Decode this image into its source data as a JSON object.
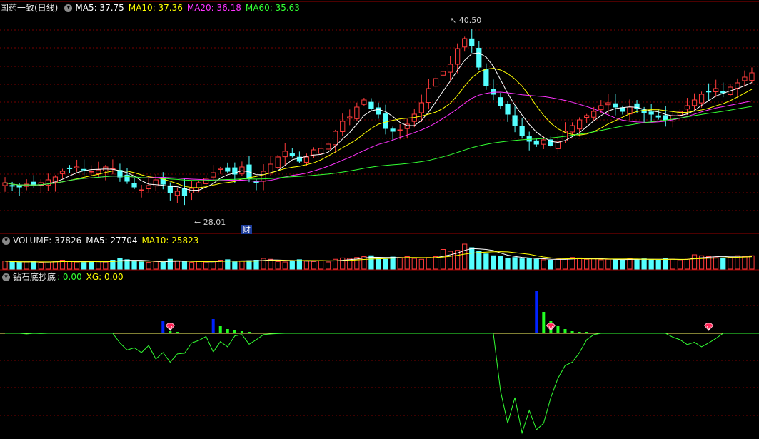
{
  "colors": {
    "up": "#ff3b3b",
    "down": "#54ffff",
    "ma5": "#ffffff",
    "ma10": "#ffff00",
    "ma20": "#ff33ff",
    "ma60": "#33ff33",
    "grid": "#7a0000",
    "zero": "#ffff66",
    "signal_line": "#33ff33",
    "signal_bar_blue": "#0022ff",
    "signal_bar_green": "#22ff22"
  },
  "price_header": {
    "stock": "国药一致(日线)",
    "ma5": "MA5: 37.75",
    "ma10": "MA10: 37.36",
    "ma20": "MA20: 36.18",
    "ma60": "MA60: 35.63"
  },
  "volume_header": {
    "volume": "VOLUME: 37826",
    "ma5": "MA5: 27704",
    "ma10": "MA10: 25823"
  },
  "indicator_header": {
    "name": "钻石底抄底",
    "value": ": 0.00",
    "xg": "XG: 0.00"
  },
  "annotations": {
    "high": "40.50",
    "low": "28.01",
    "finance_badge": "财"
  },
  "icons": {
    "panel_toggle": "chevron-down-icon",
    "signal_marker": "diamond-icon"
  },
  "chart_data": {
    "type": "candlestick",
    "price_range": [
      27.0,
      42.0
    ],
    "grid": true,
    "key_points": {
      "high": 40.5,
      "low": 28.01,
      "last_ma5": 37.75,
      "last_ma10": 37.36,
      "last_ma20": 36.18,
      "last_ma60": 35.63
    },
    "last_volume": 37826,
    "last_volume_ma5": 27704,
    "last_volume_ma10": 25823,
    "price_path": [
      30.2,
      30.0,
      29.9,
      30.1,
      30.0,
      30.2,
      30.4,
      30.6,
      31.0,
      31.2,
      31.3,
      31.1,
      31.0,
      31.1,
      31.3,
      31.2,
      30.6,
      30.3,
      29.9,
      29.7,
      30.0,
      30.4,
      30.1,
      29.5,
      29.6,
      29.3,
      29.8,
      30.2,
      30.5,
      30.9,
      31.2,
      31.0,
      30.8,
      31.3,
      30.5,
      30.2,
      31.0,
      31.5,
      32.0,
      32.4,
      32.1,
      31.7,
      32.0,
      32.5,
      32.6,
      32.9,
      33.8,
      34.5,
      34.8,
      35.5,
      36.0,
      35.4,
      35.0,
      34.0,
      33.8,
      33.9,
      34.3,
      35.0,
      35.8,
      36.8,
      37.5,
      38.0,
      38.5,
      39.6,
      40.3,
      39.8,
      38.3,
      37.0,
      36.4,
      35.6,
      35.0,
      34.2,
      33.5,
      33.1,
      32.9,
      33.2,
      32.8,
      33.1,
      33.8,
      34.2,
      34.6,
      34.9,
      35.2,
      35.6,
      35.8,
      35.5,
      35.2,
      35.5,
      35.4,
      35.1,
      35.0,
      34.8,
      34.6,
      34.9,
      35.2,
      35.6,
      36.0,
      36.4,
      36.6,
      36.8,
      36.5,
      36.9,
      37.2,
      37.6,
      37.9
    ],
    "volume_path": [
      18,
      16,
      15,
      16,
      17,
      15,
      16,
      18,
      20,
      17,
      16,
      15,
      17,
      18,
      16,
      20,
      24,
      21,
      18,
      16,
      15,
      17,
      16,
      22,
      18,
      16,
      15,
      17,
      16,
      18,
      20,
      21,
      16,
      18,
      19,
      20,
      24,
      22,
      17,
      16,
      18,
      21,
      18,
      17,
      19,
      16,
      22,
      25,
      24,
      26,
      28,
      30,
      24,
      22,
      27,
      26,
      28,
      24,
      22,
      26,
      28,
      44,
      40,
      42,
      56,
      48,
      40,
      34,
      30,
      28,
      24,
      26,
      23,
      24,
      22,
      21,
      20,
      22,
      24,
      26,
      25,
      22,
      23,
      21,
      22,
      21,
      20,
      24,
      22,
      23,
      21,
      20,
      24,
      22,
      21,
      22,
      32,
      30,
      28,
      27,
      25,
      27,
      30,
      28,
      30
    ],
    "indicator_path": [
      0,
      0,
      0,
      -2,
      0,
      -1,
      0,
      0,
      0,
      0,
      0,
      0,
      0,
      0,
      0,
      0,
      -30,
      -52,
      -45,
      -60,
      -38,
      -80,
      -60,
      -90,
      -64,
      -62,
      -30,
      -22,
      -10,
      -58,
      -26,
      -42,
      -8,
      -4,
      -34,
      -20,
      -4,
      -2,
      -1,
      0,
      0,
      0,
      0,
      0,
      0,
      0,
      0,
      0,
      0,
      0,
      0,
      0,
      0,
      0,
      0,
      0,
      0,
      0,
      0,
      0,
      0,
      0,
      0,
      0,
      0,
      0,
      0,
      0,
      0,
      -180,
      -280,
      -200,
      -310,
      -240,
      -300,
      -280,
      -200,
      -140,
      -100,
      -90,
      -60,
      -20,
      -4,
      0,
      0,
      0,
      0,
      0,
      0,
      0,
      0,
      0,
      0,
      -12,
      -20,
      -35,
      -28,
      -42,
      -30,
      -16,
      0,
      0,
      0,
      0,
      0,
      0,
      0
    ],
    "signal_bars": [
      {
        "i": 22,
        "v": 18,
        "c": "blue"
      },
      {
        "i": 29,
        "v": 20,
        "c": "blue"
      },
      {
        "i": 30,
        "v": 10,
        "c": "green"
      },
      {
        "i": 31,
        "v": 6,
        "c": "green"
      },
      {
        "i": 32,
        "v": 4,
        "c": "green"
      },
      {
        "i": 33,
        "v": 3,
        "c": "green"
      },
      {
        "i": 34,
        "v": 2,
        "c": "green"
      },
      {
        "i": 23,
        "v": 3,
        "c": "green"
      },
      {
        "i": 24,
        "v": 2,
        "c": "green"
      },
      {
        "i": 74,
        "v": 60,
        "c": "blue"
      },
      {
        "i": 75,
        "v": 30,
        "c": "green"
      },
      {
        "i": 76,
        "v": 18,
        "c": "green"
      },
      {
        "i": 77,
        "v": 10,
        "c": "green"
      },
      {
        "i": 78,
        "v": 6,
        "c": "green"
      },
      {
        "i": 79,
        "v": 3,
        "c": "green"
      },
      {
        "i": 80,
        "v": 2,
        "c": "green"
      },
      {
        "i": 81,
        "v": 2,
        "c": "green"
      }
    ],
    "markers": [
      23,
      76,
      98
    ]
  }
}
